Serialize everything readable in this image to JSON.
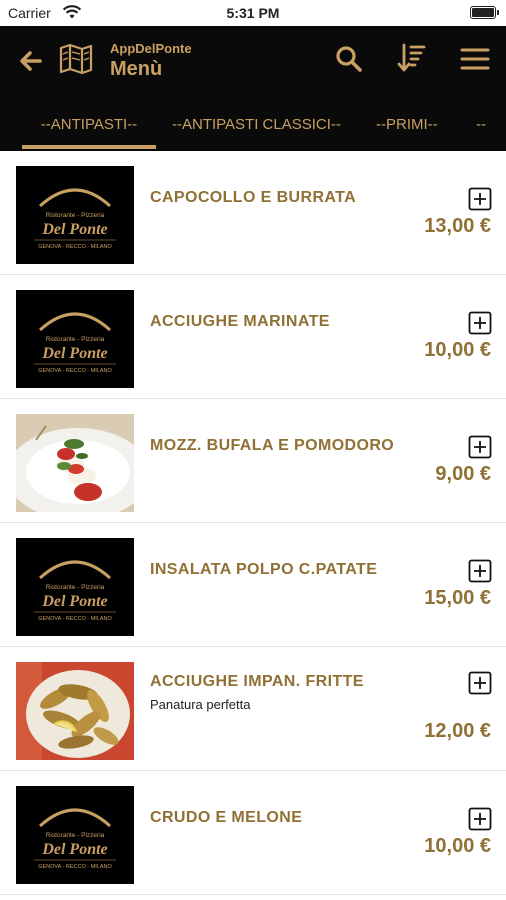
{
  "status_bar": {
    "carrier": "Carrier",
    "time": "5:31 PM"
  },
  "header": {
    "app_name": "AppDelPonte",
    "title": "Menù"
  },
  "colors": {
    "nav_background": "#0a0a0a",
    "accent": "#c9a063",
    "item_text": "#8f7035"
  },
  "tabs": [
    {
      "label": "--ANTIPASTI--",
      "selected": true
    },
    {
      "label": "--ANTIPASTI CLASSICI--",
      "selected": false
    },
    {
      "label": "--PRIMI--",
      "selected": false
    },
    {
      "label": "--",
      "selected": false
    }
  ],
  "logo": {
    "line1": "Ristorante - Pizzeria",
    "name": "Del Ponte",
    "line2": "GENOVA - RECCO - MILANO"
  },
  "items": [
    {
      "name": "CAPOCOLLO E BURRATA",
      "price": "13,00 €",
      "description": "",
      "image": "logo"
    },
    {
      "name": "ACCIUGHE MARINATE",
      "price": "10,00 €",
      "description": "",
      "image": "logo"
    },
    {
      "name": "MOZZ. BUFALA E POMODORO",
      "price": "9,00 €",
      "description": "",
      "image": "caprese-photo"
    },
    {
      "name": "INSALATA POLPO C.PATATE",
      "price": "15,00 €",
      "description": "",
      "image": "logo"
    },
    {
      "name": "ACCIUGHE IMPAN. FRITTE",
      "price": "12,00 €",
      "description": "Panatura perfetta",
      "image": "fried-anchovies-photo"
    },
    {
      "name": "CRUDO E MELONE",
      "price": "10,00 €",
      "description": "",
      "image": "logo"
    }
  ]
}
